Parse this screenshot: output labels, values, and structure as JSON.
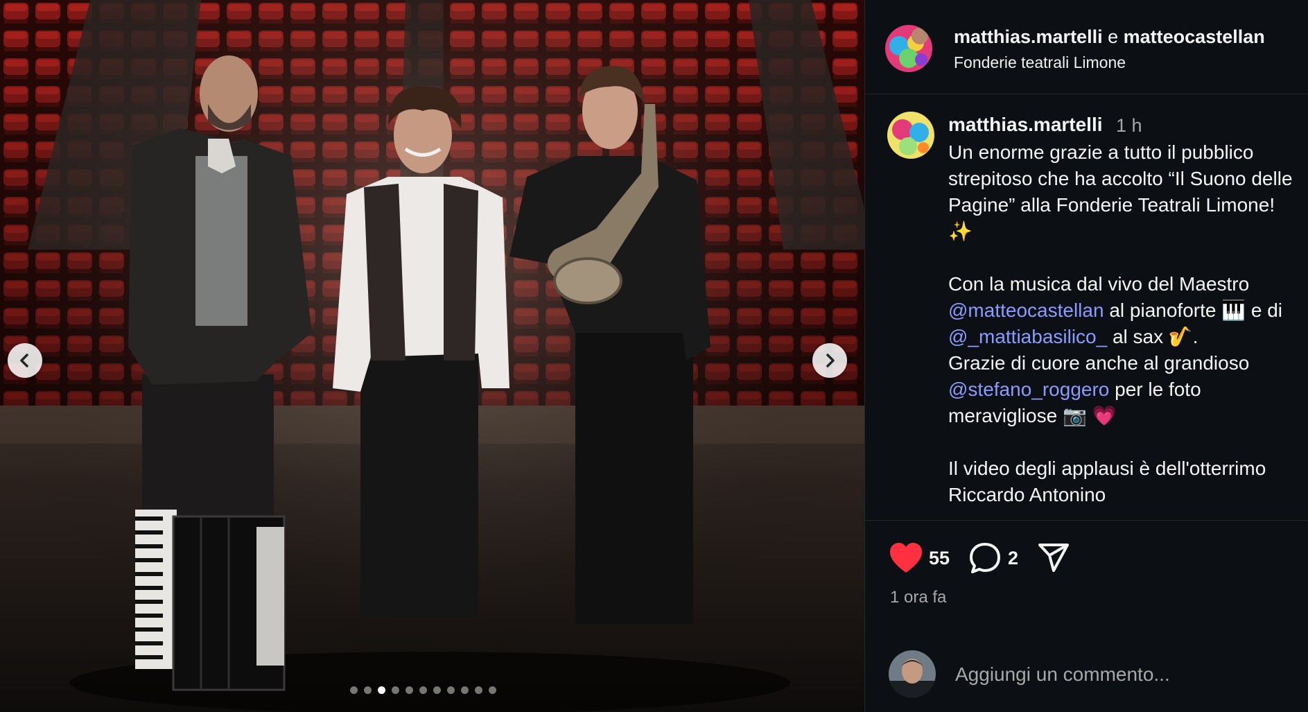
{
  "carousel": {
    "image_alt": "Three musicians standing on a theatre stage in front of red seats, with an accordion and a saxophone",
    "slide_count": 11,
    "active_index": 2
  },
  "header": {
    "user1": "matthias.martelli",
    "conjunction": "e",
    "user2": "matteocastellan",
    "location": "Fonderie teatrali Limone"
  },
  "caption": {
    "username": "matthias.martelli",
    "time": "1 h",
    "p1": "Un enorme grazie a tutto il pubblico strepitoso che ha accolto “Il Suono delle Pagine” alla Fonderie Teatrali Limone! ✨",
    "p2_a": "Con la musica dal vivo del Maestro ",
    "p2_m1": "@matteocastellan",
    "p2_b": " al pianoforte 🎹 e di ",
    "p2_m2": "@_mattiabasilico_",
    "p2_c": " al sax 🎷.",
    "p2_d": "Grazie di cuore anche al grandioso ",
    "p2_m3": "@stefano_roggero",
    "p2_e": " per le foto meravigliose 📷 💗",
    "p3": "Il video degli applausi è dell'otterrimo Riccardo Antonino"
  },
  "actions": {
    "likes": "55",
    "comments": "2",
    "like_color": "#ff3040"
  },
  "time_ago": "1 ora fa",
  "comment_box": {
    "placeholder": "Aggiungi un commento..."
  },
  "icons": {
    "like": "heart-icon",
    "comment": "comment-bubble-icon",
    "share": "send-icon",
    "prev": "chevron-left-icon",
    "next": "chevron-right-icon"
  }
}
